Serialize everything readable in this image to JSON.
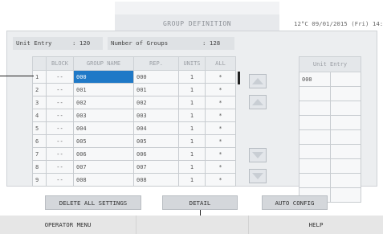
{
  "header": {
    "title": "GROUP DEFINITION",
    "datetime": "12°C  09/01/2015 (Fri) 14:"
  },
  "stats": {
    "unit_entry_label": "Unit Entry",
    "unit_entry_value": ": 120",
    "groups_label": "Number of Groups",
    "groups_value": ": 128"
  },
  "table": {
    "headers": [
      "",
      "BLOCK",
      "GROUP NAME",
      "REP.",
      "UNITS",
      "ALL"
    ],
    "rows": [
      {
        "num": "1",
        "block": "--",
        "name": "000",
        "rep": "000",
        "units": "1",
        "all": "*"
      },
      {
        "num": "2",
        "block": "--",
        "name": "001",
        "rep": "001",
        "units": "1",
        "all": "*"
      },
      {
        "num": "3",
        "block": "--",
        "name": "002",
        "rep": "002",
        "units": "1",
        "all": "*"
      },
      {
        "num": "4",
        "block": "--",
        "name": "003",
        "rep": "003",
        "units": "1",
        "all": "*"
      },
      {
        "num": "5",
        "block": "--",
        "name": "004",
        "rep": "004",
        "units": "1",
        "all": "*"
      },
      {
        "num": "6",
        "block": "--",
        "name": "005",
        "rep": "005",
        "units": "1",
        "all": "*"
      },
      {
        "num": "7",
        "block": "--",
        "name": "006",
        "rep": "006",
        "units": "1",
        "all": "*"
      },
      {
        "num": "8",
        "block": "--",
        "name": "007",
        "rep": "007",
        "units": "1",
        "all": "*"
      },
      {
        "num": "9",
        "block": "--",
        "name": "008",
        "rep": "008",
        "units": "1",
        "all": "*"
      }
    ]
  },
  "unit_entry_table": {
    "header": "Unit Entry",
    "first_value": "000"
  },
  "buttons": {
    "delete_all": "DELETE ALL SETTINGS",
    "detail": "DETAIL",
    "auto_config": "AUTO CONFIG"
  },
  "footer": {
    "operator_menu": "OPERATOR MENU",
    "help": "HELP"
  },
  "colors": {
    "selection": "#1f79c7",
    "panel": "#eceef0"
  }
}
